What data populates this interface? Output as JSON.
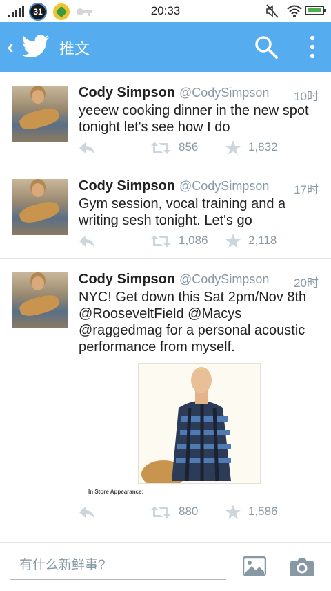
{
  "status_bar": {
    "time": "20:33",
    "notification_badge": "31",
    "battery_color": "#4caf50"
  },
  "action_bar": {
    "title": "推文",
    "background_color": "#55acee",
    "back_icon": "chevron-left-icon",
    "logo_icon": "twitter-bird-icon",
    "search_icon": "search-icon",
    "overflow_icon": "more-vertical-icon"
  },
  "tweets": [
    {
      "name": "Cody Simpson",
      "handle": "@CodySimpson",
      "time": "10时",
      "text": "yeeew cooking dinner in the new spot tonight let's see how I do",
      "retweets": "856",
      "favorites": "1,832"
    },
    {
      "name": "Cody Simpson",
      "handle": "@CodySimpson",
      "time": "17时",
      "text": "Gym session, vocal training and a writing sesh tonight. Let's go",
      "retweets": "1,086",
      "favorites": "2,118"
    },
    {
      "name": "Cody Simpson",
      "handle": "@CodySimpson",
      "time": "20时",
      "text": "NYC! Get down this Sat 2pm/Nov 8th @RooseveltField @Macys @raggedmag for a personal acoustic performance from myself.",
      "media_caption": "In Store Appearance:",
      "retweets": "880",
      "favorites": "1,586"
    }
  ],
  "compose": {
    "placeholder": "有什么新鲜事?",
    "photo_icon": "image-icon",
    "camera_icon": "camera-icon"
  }
}
